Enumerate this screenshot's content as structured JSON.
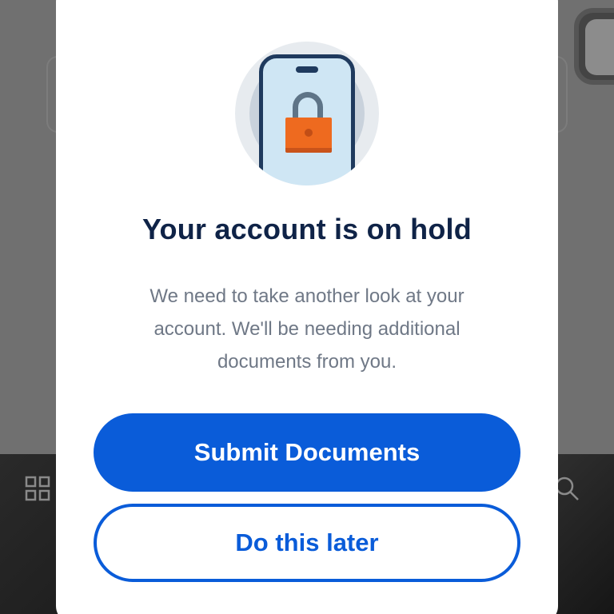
{
  "modal": {
    "illustration_icon": "phone-lock-icon",
    "title": "Your account is on hold",
    "message": "We need to take another look at your account. We'll be needing additional documents from you.",
    "primary_button_label": "Submit Documents",
    "secondary_button_label": "Do this later"
  },
  "background": {
    "left_nav_icon": "grid-icon",
    "right_nav_icon": "search-icon"
  },
  "colors": {
    "accent": "#0a5cd9",
    "title": "#0f2347",
    "body_text": "#6f7886",
    "lock": "#ee6a1f"
  }
}
